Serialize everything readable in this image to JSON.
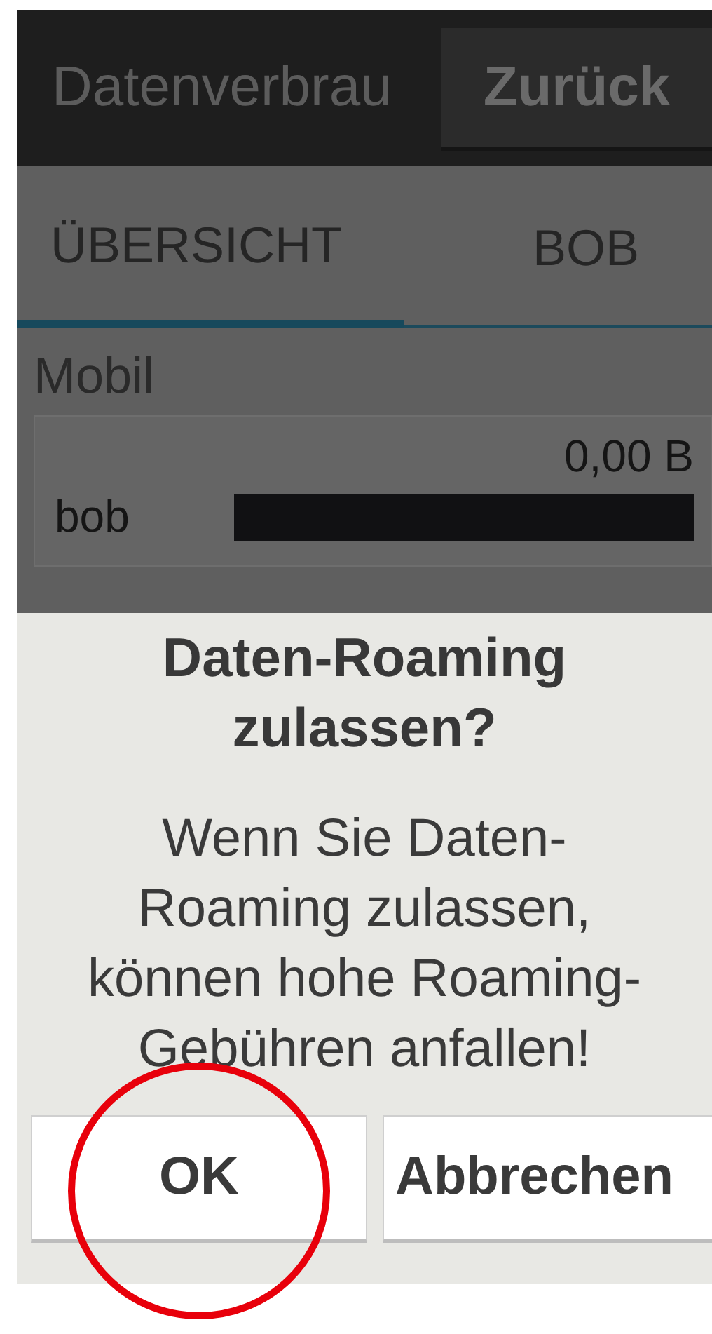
{
  "action_bar": {
    "title": "Datenverbrau",
    "back_button": "Zurück"
  },
  "tabs": [
    {
      "label": "ÜBERSICHT",
      "selected": true
    },
    {
      "label": "BOB",
      "selected": false
    }
  ],
  "sections": [
    {
      "label": "Mobil",
      "usage": {
        "amount": "0,00 B",
        "rows": [
          {
            "name": "bob"
          }
        ]
      }
    }
  ],
  "dialog": {
    "title": "Daten-Roaming zulassen?",
    "message": "Wenn Sie Daten-Roaming zulassen, können hohe Roaming-Gebühren anfallen!",
    "buttons": [
      {
        "label": "OK",
        "circled": true
      },
      {
        "label": "Abbrechen",
        "circled": false
      }
    ]
  }
}
